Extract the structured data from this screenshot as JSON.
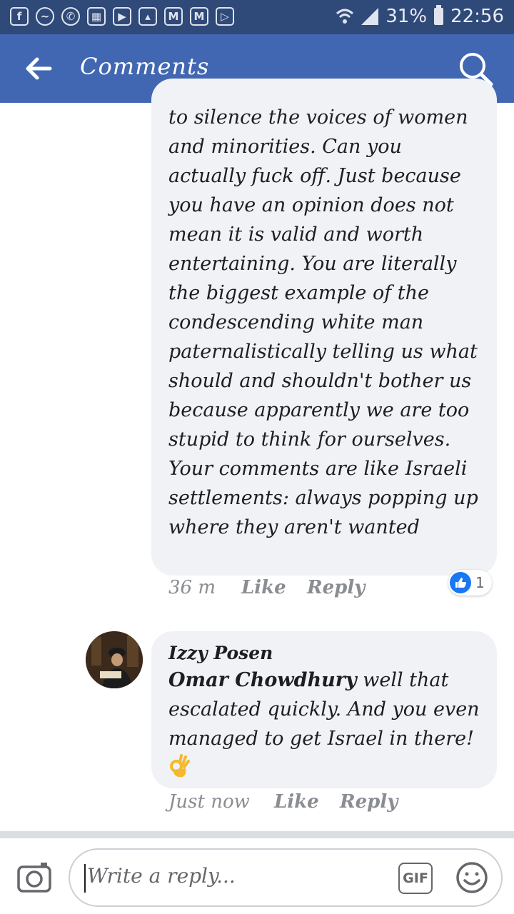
{
  "status_bar": {
    "battery": "31%",
    "time": "22:56",
    "icons": [
      "facebook-icon",
      "messenger-icon",
      "whatsapp-icon",
      "calendar-icon",
      "youtube-icon",
      "gallery-icon",
      "gmail-icon",
      "gmail-icon",
      "play-store-icon",
      "wifi-icon",
      "signal-icon",
      "battery-icon"
    ]
  },
  "app_bar": {
    "title": "Comments",
    "back_icon": "arrow-left-icon",
    "search_icon": "search-icon",
    "background": "#4267b2"
  },
  "comments": [
    {
      "text": "to silence the voices of women and minorities. Can you actually fuck off. Just because you have an opinion does not mean it is valid and worth entertaining. You are literally the biggest example of the condescending white man paternalistically telling us what should and shouldn't bother us because apparently we are too stupid to think for ourselves. Your comments are like Israeli settlements: always popping up where they aren't wanted",
      "time": "36 m",
      "like_label": "Like",
      "reply_label": "Reply",
      "reaction_count": "1"
    },
    {
      "author": "Izzy Posen",
      "mention": "Omar Chowdhury",
      "text": " well that escalated quickly. And you even managed to get Israel in there! ",
      "emoji": "ok-hand-icon",
      "time": "Just now",
      "like_label": "Like",
      "reply_label": "Reply"
    }
  ],
  "composer": {
    "placeholder": "Write a reply...",
    "gif_label": "GIF",
    "camera_icon": "camera-icon",
    "emoji_icon": "smiley-icon"
  }
}
